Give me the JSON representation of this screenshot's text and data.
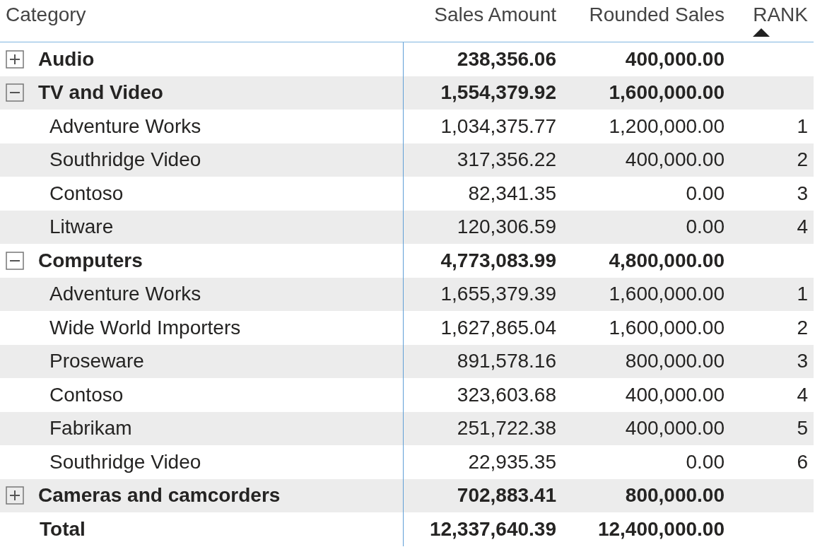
{
  "columns": [
    {
      "label": "Category",
      "sorted": false
    },
    {
      "label": "Sales Amount",
      "sorted": false
    },
    {
      "label": "Rounded Sales",
      "sorted": false
    },
    {
      "label": "RANK",
      "sorted": true
    }
  ],
  "rows": [
    {
      "label": "Audio",
      "sales": "238,356.06",
      "rounded": "400,000.00",
      "expanded": false,
      "children": []
    },
    {
      "label": "TV and Video",
      "sales": "1,554,379.92",
      "rounded": "1,600,000.00",
      "expanded": true,
      "children": [
        {
          "label": "Adventure Works",
          "sales": "1,034,375.77",
          "rounded": "1,200,000.00",
          "rank": "1"
        },
        {
          "label": "Southridge Video",
          "sales": "317,356.22",
          "rounded": "400,000.00",
          "rank": "2"
        },
        {
          "label": "Contoso",
          "sales": "82,341.35",
          "rounded": "0.00",
          "rank": "3"
        },
        {
          "label": "Litware",
          "sales": "120,306.59",
          "rounded": "0.00",
          "rank": "4"
        }
      ]
    },
    {
      "label": "Computers",
      "sales": "4,773,083.99",
      "rounded": "4,800,000.00",
      "expanded": true,
      "children": [
        {
          "label": "Adventure Works",
          "sales": "1,655,379.39",
          "rounded": "1,600,000.00",
          "rank": "1"
        },
        {
          "label": "Wide World Importers",
          "sales": "1,627,865.04",
          "rounded": "1,600,000.00",
          "rank": "2"
        },
        {
          "label": "Proseware",
          "sales": "891,578.16",
          "rounded": "800,000.00",
          "rank": "3"
        },
        {
          "label": "Contoso",
          "sales": "323,603.68",
          "rounded": "400,000.00",
          "rank": "4"
        },
        {
          "label": "Fabrikam",
          "sales": "251,722.38",
          "rounded": "400,000.00",
          "rank": "5"
        },
        {
          "label": "Southridge Video",
          "sales": "22,935.35",
          "rounded": "0.00",
          "rank": "6"
        }
      ]
    },
    {
      "label": "Cameras and camcorders",
      "sales": "702,883.41",
      "rounded": "800,000.00",
      "expanded": false,
      "children": []
    }
  ],
  "total": {
    "label": "Total",
    "sales": "12,337,640.39",
    "rounded": "12,400,000.00"
  }
}
